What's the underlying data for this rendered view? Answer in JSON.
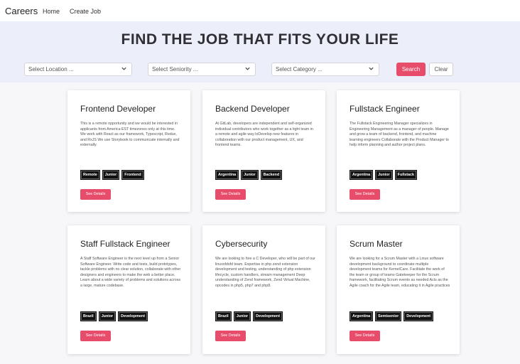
{
  "nav": {
    "brand": "Careers",
    "links": [
      "Home",
      "Create Job"
    ]
  },
  "hero": {
    "title": "FIND THE JOB THAT FITS YOUR LIFE"
  },
  "filters": {
    "location_placeholder": "Select Location ...",
    "seniority_placeholder": "Select Seniority ...",
    "category_placeholder": "Select Category ...",
    "search_label": "Search",
    "clear_label": "Clear"
  },
  "colors": {
    "accent": "#e84c6b",
    "hero_bg": "#eceef9"
  },
  "jobs": [
    {
      "title": "Frontend Developer",
      "description": "This is a remote opportunity and we would be interested in applicants from America EST timezones only at this time. We work with React as our framework, Typescript, Redux, and RxJS We use Storybook to communicate internally and externally.",
      "tags": [
        "Remote",
        "Junior",
        "Frontend"
      ],
      "button": "See Details"
    },
    {
      "title": "Backend Developer",
      "description": "At GitLab, developers are independent and self-organized individual contributors who work together as a tight team in a remote and agile way.\\nDevelop new features in collaboration with our product management, UX, and frontend teams.",
      "tags": [
        "Argentina",
        "Junior",
        "Backend"
      ],
      "button": "See Details"
    },
    {
      "title": "Fullstack Engineer",
      "description": "The Fullstack Engineering Manager specializes in Engineering Management as a manager of people. Manage and grow a team of backend, frontend, and machine learning engineers Collaborate with the Product Manager to help inform planning and author project plans.",
      "tags": [
        "Argentina",
        "Junior",
        "Fullstack"
      ],
      "button": "See Details"
    },
    {
      "title": "Staff Fullstack Engineer",
      "description": "A Staff Software Engineer is the next level up from a Senior Software Engineer. Write code and tests, build prototypes, tackle problems with no clear solution, collaborate with other designers and engineers to make the web a better place. Learn about a wide variety of problems and solutions across a large, mature codebase.",
      "tags": [
        "Brazil",
        "Junior",
        "Development"
      ],
      "button": "See Details"
    },
    {
      "title": "Cybersecurity",
      "description": "We are looking to hire a C Developer, who will be part of our linuxsfdsfd team. Expertise in php zend extension development and testing, understanding of php extension lifecycle, custom handlers, stream management Deep understanding of Zend framework, Zend Virtual Machine, opcodes in php5, php7 and php8.",
      "tags": [
        "Brazil",
        "Junior",
        "Development"
      ],
      "button": "See Details"
    },
    {
      "title": "Scrum Master",
      "description": "We are looking for a Scrum Master with a Linux software development background to coordinate multiple development teams for KernelCare. Facilitate the work of the team or group of teams Gatekeeper for the Scrum framework, facilitating Scrum events as needed Acts as the Agile coach for the Agile team, educating it in Agile practices",
      "tags": [
        "Argentina",
        "Semisenior",
        "Development"
      ],
      "button": "See Details"
    }
  ]
}
